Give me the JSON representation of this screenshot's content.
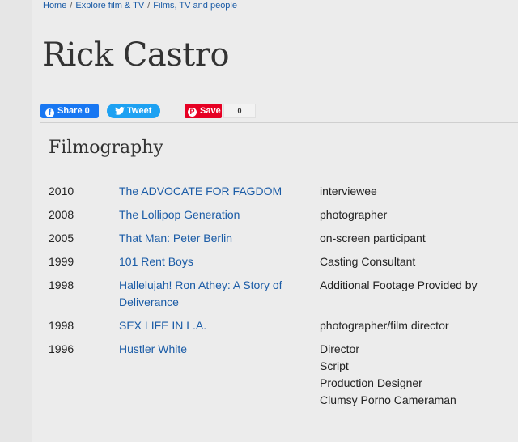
{
  "breadcrumb": {
    "items": [
      "Home",
      "Explore film & TV",
      "Films, TV and people"
    ],
    "separator": "/"
  },
  "page_title": "Rick Castro",
  "share": {
    "facebook": {
      "label": "Share",
      "count": "0",
      "color": "#1877f2"
    },
    "twitter": {
      "label": "Tweet",
      "color": "#1da1f2"
    },
    "pinterest": {
      "label": "Save",
      "count": "0",
      "color": "#e60023"
    }
  },
  "filmography": {
    "heading": "Filmography",
    "rows": [
      {
        "year": "2010",
        "title": "The ADVOCATE FOR FAGDOM",
        "roles": [
          "interviewee"
        ]
      },
      {
        "year": "2008",
        "title": "The Lollipop Generation",
        "roles": [
          "photographer"
        ]
      },
      {
        "year": "2005",
        "title": "That Man: Peter Berlin",
        "roles": [
          "on-screen participant"
        ]
      },
      {
        "year": "1999",
        "title": "101 Rent Boys",
        "roles": [
          "Casting Consultant"
        ]
      },
      {
        "year": "1998",
        "title": "Hallelujah! Ron Athey: A Story of Deliverance",
        "roles": [
          "Additional Footage Provided by"
        ]
      },
      {
        "year": "1998",
        "title": "SEX LIFE IN L.A.",
        "roles": [
          "photographer/film director"
        ]
      },
      {
        "year": "1996",
        "title": "Hustler White",
        "roles": [
          "Director",
          "Script",
          "Production Designer",
          "Clumsy Porno Cameraman"
        ]
      }
    ]
  },
  "colors": {
    "link": "#1a5ba6",
    "background": "#ececec"
  }
}
